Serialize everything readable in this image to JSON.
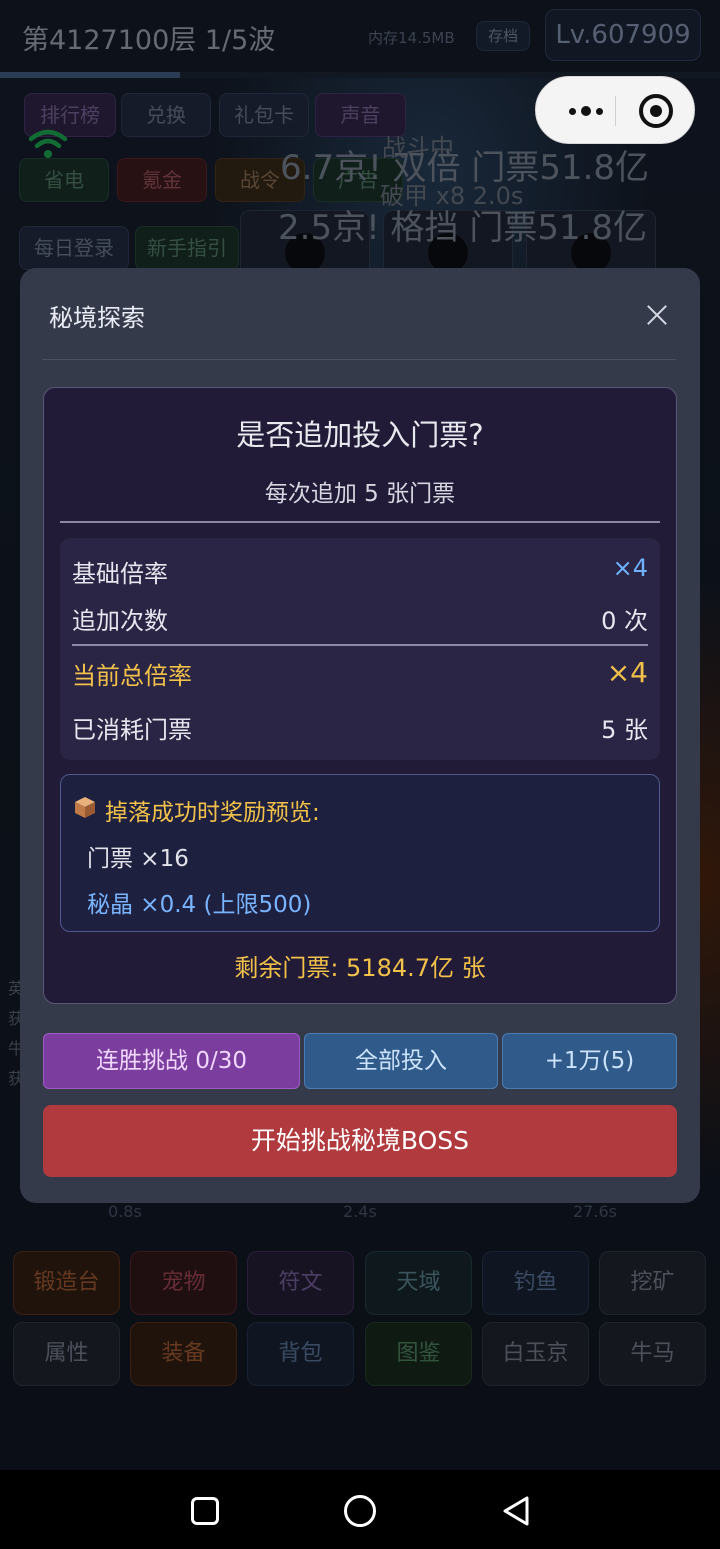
{
  "status": {
    "floor_wave": "第4127100层  1/5波",
    "memory": "内存14.5MB",
    "save_label": "存档",
    "level": "Lv.607909",
    "progress": 0.25
  },
  "top_menu": {
    "row1": [
      "排行榜",
      "兑换",
      "礼包卡",
      "声音"
    ],
    "row2": [
      "省电",
      "氪金",
      "战令",
      "广告"
    ],
    "row3": [
      "每日登录",
      "新手指引"
    ]
  },
  "battle_log": {
    "line1": "6.7京! 双倍 门票51.8亿",
    "line1_prefix": "战斗中",
    "line2": "破甲 x8 2.0s",
    "line3": "2.5京! 格挡 门票51.8亿"
  },
  "side_labels": [
    "英",
    "获",
    "牛",
    "获"
  ],
  "time_labels": [
    "0.8s",
    "2.4s",
    "27.6s"
  ],
  "bottom_nav": {
    "row1": [
      "锻造台",
      "宠物",
      "符文",
      "天域",
      "钓鱼",
      "挖矿"
    ],
    "row2": [
      "属性",
      "装备",
      "背包",
      "图鉴",
      "白玉京",
      "牛马"
    ]
  },
  "modal": {
    "title": "秘境探索",
    "question": "是否追加投入门票?",
    "subtitle": "每次追加 5 张门票",
    "stats": {
      "base_rate_label": "基础倍率",
      "base_rate_value": "×4",
      "add_count_label": "追加次数",
      "add_count_value": "0 次",
      "total_rate_label": "当前总倍率",
      "total_rate_value": "×4",
      "consumed_label": "已消耗门票",
      "consumed_value": "5 张"
    },
    "reward": {
      "title": "掉落成功时奖励预览:",
      "ticket": "门票 ×16",
      "crystal": "秘晶 ×0.4 (上限500)"
    },
    "remaining": "剩余门票: 5184.7亿 张",
    "buttons": {
      "streak": "连胜挑战 0/30",
      "all_in": "全部投入",
      "add": "+1万(5)",
      "start": "开始挑战秘境BOSS"
    }
  },
  "colors": {
    "accent_gold": "#f2c14a",
    "accent_blue": "#6fb2ff",
    "start_red": "#b03a3e",
    "streak_purple": "#7b3d9e",
    "action_blue": "#2f5a8a"
  },
  "icons": {
    "wifi": "wifi-icon",
    "more": "more-dots-icon",
    "target": "target-icon",
    "close": "close-icon",
    "reward": "box-icon",
    "sys_recent": "square-icon",
    "sys_home": "circle-icon",
    "sys_back": "triangle-back-icon"
  }
}
